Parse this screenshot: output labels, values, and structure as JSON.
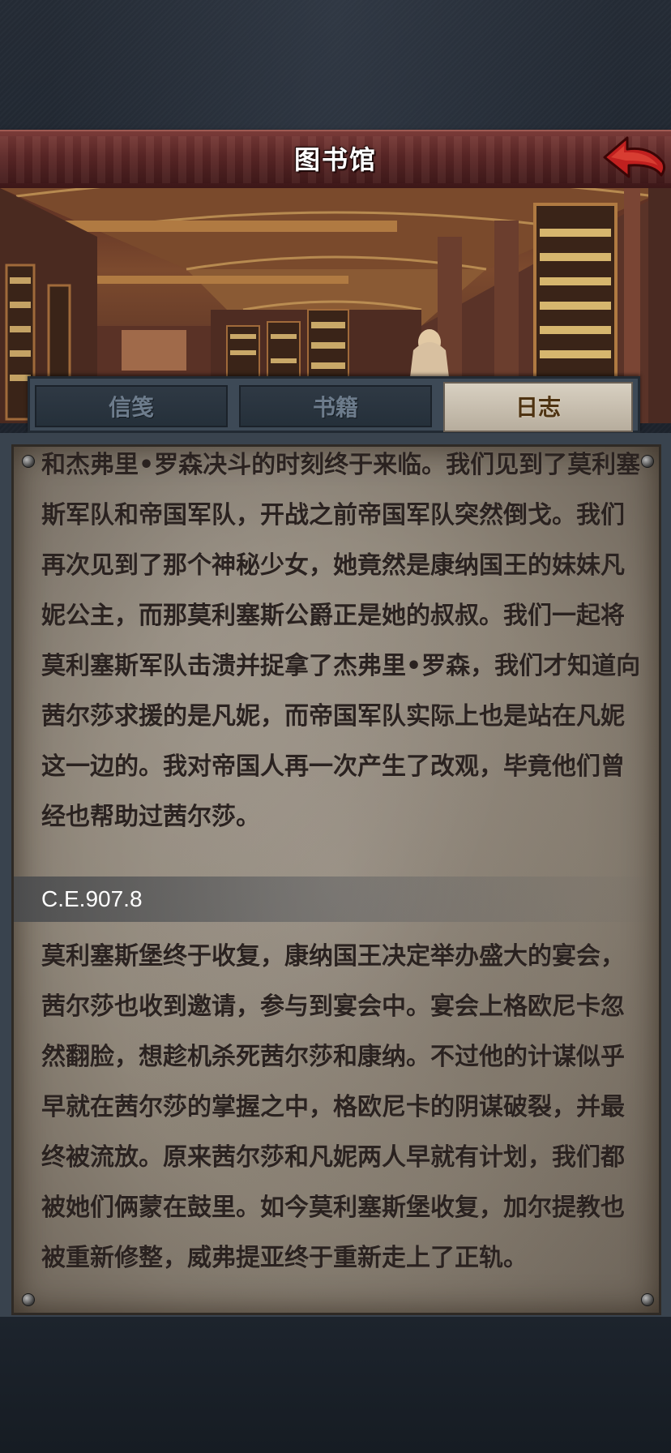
{
  "header": {
    "title": "图书馆",
    "back_icon": "back-arrow-icon"
  },
  "tabs": [
    {
      "label": "信笺",
      "active": false
    },
    {
      "label": "书籍",
      "active": false
    },
    {
      "label": "日志",
      "active": true
    }
  ],
  "log": {
    "entry1_lines": [
      "和杰弗里•罗森决斗的时刻终于来临。我们见到了莫利塞",
      "斯军队和帝国军队，开战之前帝国军队突然倒戈。我们",
      "再次见到了那个神秘少女，她竟然是康纳国王的妹妹凡",
      "妮公主，而那莫利塞斯公爵正是她的叔叔。我们一起将",
      "莫利塞斯军队击溃并捉拿了杰弗里•罗森，我们才知道向",
      "茜尔莎求援的是凡妮，而帝国军队实际上也是站在凡妮",
      "这一边的。我对帝国人再一次产生了改观，毕竟他们曾",
      "经也帮助过茜尔莎。"
    ],
    "date": "C.E.907.8",
    "entry2_lines": [
      "莫利塞斯堡终于收复，康纳国王决定举办盛大的宴会，",
      "茜尔莎也收到邀请，参与到宴会中。宴会上格欧尼卡忽",
      "然翻脸，想趁机杀死茜尔莎和康纳。不过他的计谋似乎",
      "早就在茜尔莎的掌握之中，格欧尼卡的阴谋破裂，并最",
      "终被流放。原来茜尔莎和凡妮两人早就有计划，我们都",
      "被她们俩蒙在鼓里。如今莫利塞斯堡收复，加尔提教也",
      "被重新修整，威弗提亚终于重新走上了正轨。"
    ]
  },
  "colors": {
    "header": "#5a2626",
    "tab_active": "#d8d0c1",
    "parchment": "#9f968a",
    "text": "#2a2220",
    "back_arrow": "#c0201f"
  }
}
